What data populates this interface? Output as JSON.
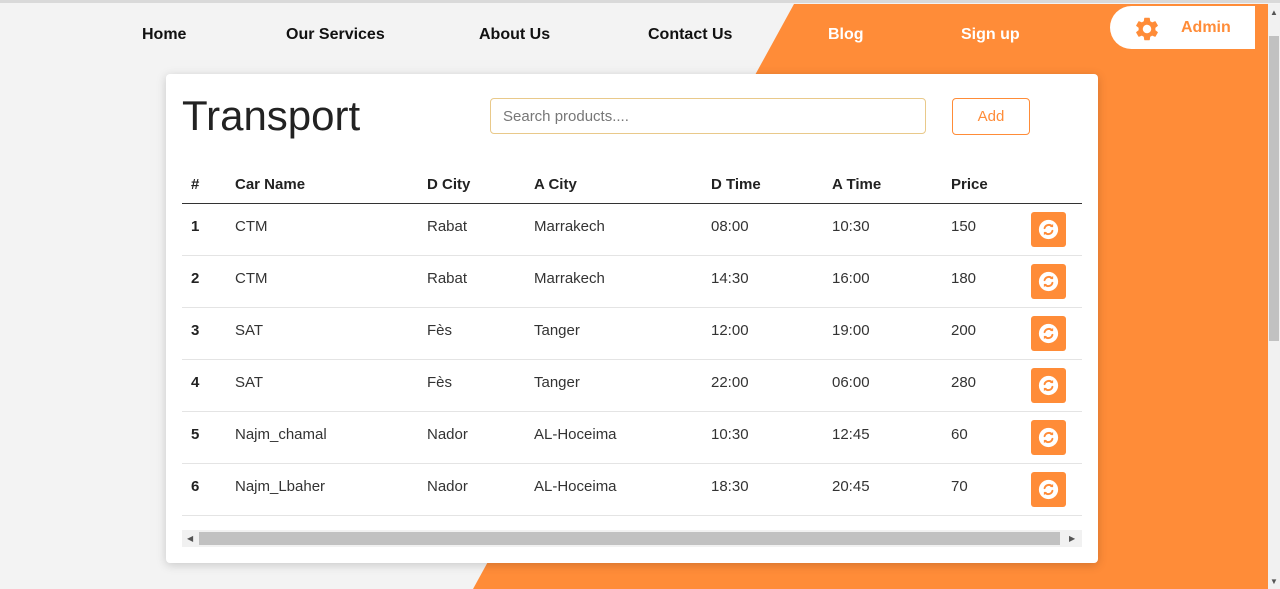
{
  "nav": {
    "home": "Home",
    "services": "Our Services",
    "about": "About Us",
    "contact": "Contact Us",
    "blog": "Blog",
    "signup": "Sign up",
    "admin": "Admin"
  },
  "colors": {
    "accent": "#ff8c38",
    "background": "#f3f3f3",
    "card": "#ffffff"
  },
  "page": {
    "title": "Transport",
    "search_placeholder": "Search products....",
    "add_label": "Add"
  },
  "table": {
    "headers": [
      "#",
      "Car Name",
      "D City",
      "A City",
      "D Time",
      "A Time",
      "Price"
    ],
    "rows": [
      [
        "1",
        "CTM",
        "Rabat",
        "Marrakech",
        "08:00",
        "10:30",
        "150"
      ],
      [
        "2",
        "CTM",
        "Rabat",
        "Marrakech",
        "14:30",
        "16:00",
        "180"
      ],
      [
        "3",
        "SAT",
        "Fès",
        "Tanger",
        "12:00",
        "19:00",
        "200"
      ],
      [
        "4",
        "SAT",
        "Fès",
        "Tanger",
        "22:00",
        "06:00",
        "280"
      ],
      [
        "5",
        "Najm_chamal",
        "Nador",
        "AL-Hoceima",
        "10:30",
        "12:45",
        "60"
      ],
      [
        "6",
        "Najm_Lbaher",
        "Nador",
        "AL-Hoceima",
        "18:30",
        "20:45",
        "70"
      ]
    ],
    "row_action_icon": "refresh-icon"
  }
}
